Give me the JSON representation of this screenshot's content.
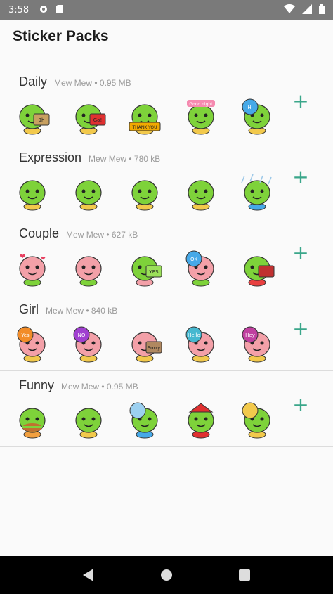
{
  "status_bar": {
    "time": "3:58"
  },
  "app_bar": {
    "title": "Sticker Packs"
  },
  "packs": [
    {
      "name": "Daily",
      "meta": "Mew Mew • 0.95 MB",
      "add_label": "+",
      "stickers": [
        {
          "body": "#7ed23a",
          "accent": "#f2c94c",
          "prop": "sign",
          "prop_color": "#c8a060",
          "prop_text": "9h"
        },
        {
          "body": "#7ed23a",
          "accent": "#f2c94c",
          "prop": "sign",
          "prop_color": "#e03030",
          "prop_text": "Go!"
        },
        {
          "body": "#7ed23a",
          "accent": "#f2c94c",
          "prop": "banner",
          "prop_color": "#f2a900",
          "prop_text": "THANK YOU"
        },
        {
          "body": "#7ed23a",
          "accent": "#f2c94c",
          "prop": "tag",
          "prop_color": "#f58ab0",
          "prop_text": "Good night"
        },
        {
          "body": "#7ed23a",
          "accent": "#f2c94c",
          "prop": "bubble",
          "prop_color": "#46a9e8",
          "prop_text": "Hi"
        }
      ]
    },
    {
      "name": "Expression",
      "meta": "Mew Mew • 780 kB",
      "add_label": "+",
      "stickers": [
        {
          "body": "#7ed23a",
          "accent": "#f2c94c",
          "prop": "none",
          "prop_color": "#ffffff",
          "prop_text": ""
        },
        {
          "body": "#7ed23a",
          "accent": "#f2c94c",
          "prop": "none",
          "prop_color": "#ffffff",
          "prop_text": ""
        },
        {
          "body": "#7ed23a",
          "accent": "#f2c94c",
          "prop": "none",
          "prop_color": "#ffffff",
          "prop_text": ""
        },
        {
          "body": "#7ed23a",
          "accent": "#f2c94c",
          "prop": "none",
          "prop_color": "#ffffff",
          "prop_text": ""
        },
        {
          "body": "#7ed23a",
          "accent": "#46a9e8",
          "prop": "rain",
          "prop_color": "#9cc8e8",
          "prop_text": ""
        }
      ]
    },
    {
      "name": "Couple",
      "meta": "Mew Mew • 627 kB",
      "add_label": "+",
      "stickers": [
        {
          "body": "#f3a0a8",
          "accent": "#7ed23a",
          "prop": "hearts",
          "prop_color": "#e84060",
          "prop_text": ""
        },
        {
          "body": "#f3a0a8",
          "accent": "#7ed23a",
          "prop": "none",
          "prop_color": "#ffffff",
          "prop_text": ""
        },
        {
          "body": "#7ed23a",
          "accent": "#f3a0a8",
          "prop": "sign",
          "prop_color": "#9be05a",
          "prop_text": "YES"
        },
        {
          "body": "#f3a0a8",
          "accent": "#7ed23a",
          "prop": "bubble",
          "prop_color": "#46a9e8",
          "prop_text": "OK"
        },
        {
          "body": "#7ed23a",
          "accent": "#e84040",
          "prop": "box",
          "prop_color": "#c03030",
          "prop_text": ""
        }
      ]
    },
    {
      "name": "Girl",
      "meta": "Mew Mew • 840 kB",
      "add_label": "+",
      "stickers": [
        {
          "body": "#f3a0a8",
          "accent": "#f2c94c",
          "prop": "bubble",
          "prop_color": "#f28c28",
          "prop_text": "Yes"
        },
        {
          "body": "#f3a0a8",
          "accent": "#f2c94c",
          "prop": "bubble",
          "prop_color": "#a040d0",
          "prop_text": "NO"
        },
        {
          "body": "#f3a0a8",
          "accent": "#f2c94c",
          "prop": "box",
          "prop_color": "#b08860",
          "prop_text": "Sorry"
        },
        {
          "body": "#f3a0a8",
          "accent": "#f2c94c",
          "prop": "bubble",
          "prop_color": "#46b8d0",
          "prop_text": "Hello"
        },
        {
          "body": "#f3a0a8",
          "accent": "#f2c94c",
          "prop": "bubble",
          "prop_color": "#c040a0",
          "prop_text": "Hey"
        }
      ]
    },
    {
      "name": "Funny",
      "meta": "Mew Mew • 0.95 MB",
      "add_label": "+",
      "stickers": [
        {
          "body": "#7ed23a",
          "accent": "#f2a040",
          "prop": "burger",
          "prop_color": "#c07030",
          "prop_text": ""
        },
        {
          "body": "#7ed23a",
          "accent": "#f2c94c",
          "prop": "none",
          "prop_color": "#ffffff",
          "prop_text": ""
        },
        {
          "body": "#7ed23a",
          "accent": "#46a9e8",
          "prop": "bubble",
          "prop_color": "#9cd0f0",
          "prop_text": ""
        },
        {
          "body": "#7ed23a",
          "accent": "#e03030",
          "prop": "hat",
          "prop_color": "#e03030",
          "prop_text": ""
        },
        {
          "body": "#7ed23a",
          "accent": "#f2c94c",
          "prop": "bubble",
          "prop_color": "#f2c94c",
          "prop_text": ""
        }
      ]
    }
  ],
  "nav": {
    "back_icon": "back-triangle-icon",
    "home_icon": "home-circle-icon",
    "recents_icon": "recents-square-icon"
  }
}
